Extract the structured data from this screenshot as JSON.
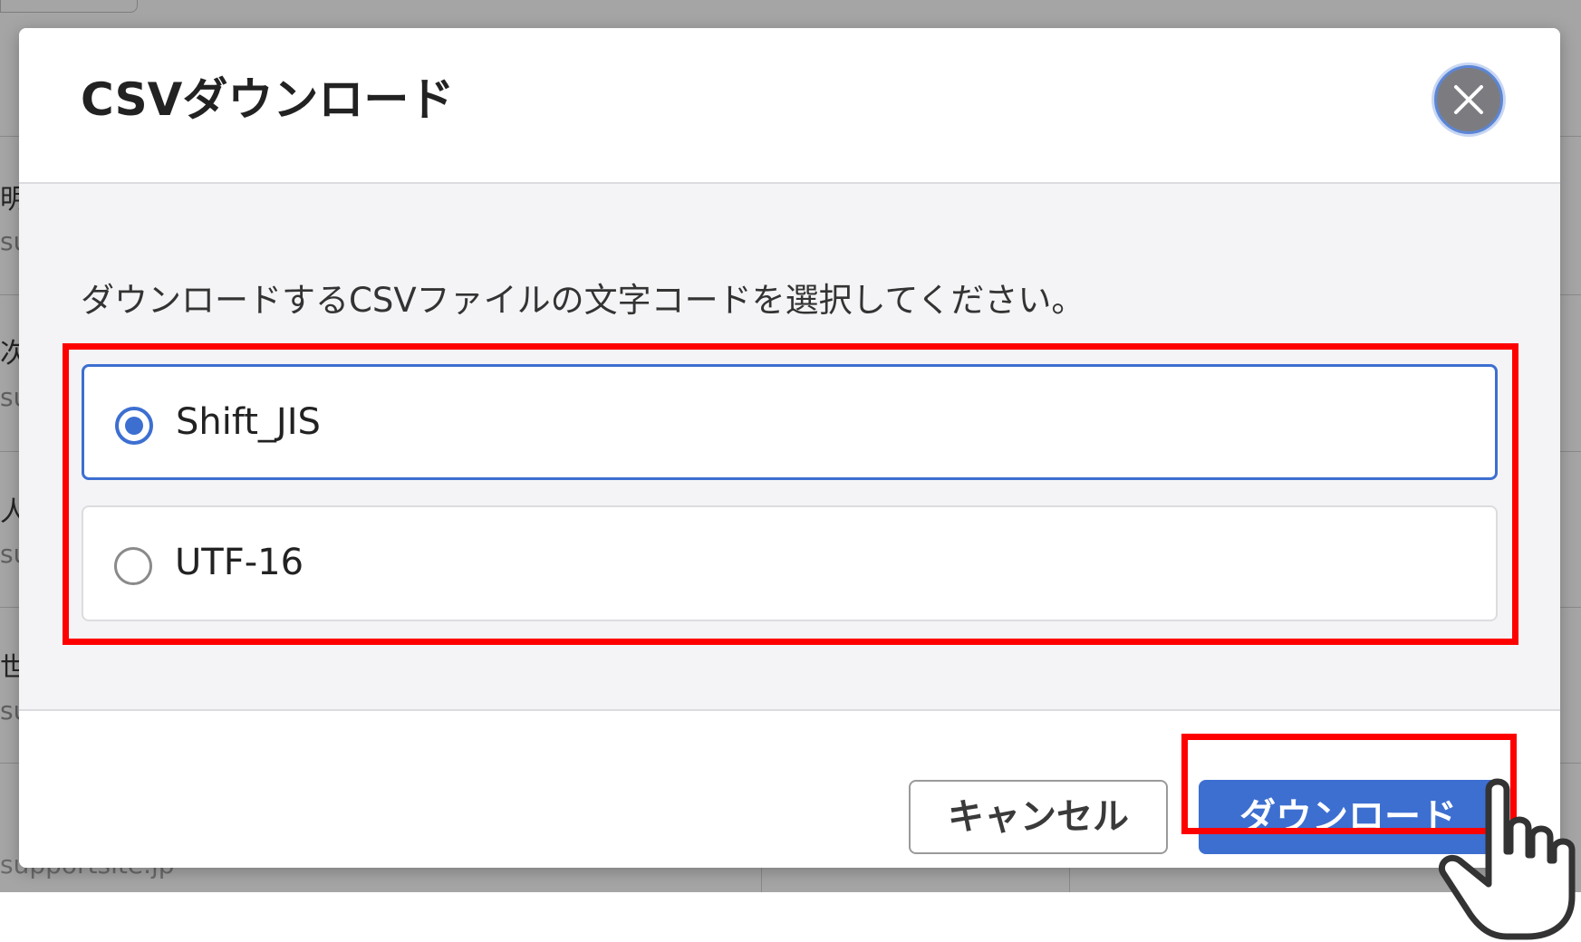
{
  "background": {
    "row_labels": [
      "明",
      "次",
      "人",
      "世"
    ],
    "row_sub": "su",
    "footer_text": "supportsite.jp"
  },
  "dialog": {
    "title": "CSVダウンロード",
    "close_icon": "close-icon",
    "instruction": "ダウンロードするCSVファイルの文字コードを選択してください。",
    "options": [
      {
        "label": "Shift_JIS",
        "selected": true
      },
      {
        "label": "UTF-16",
        "selected": false
      }
    ],
    "cancel_label": "キャンセル",
    "download_label": "ダウンロード"
  },
  "colors": {
    "accent": "#3d6fd1",
    "highlight": "#ff0000",
    "overlay": "rgba(40,40,40,0.42)"
  },
  "cursor_icon": "hand-pointer-icon"
}
